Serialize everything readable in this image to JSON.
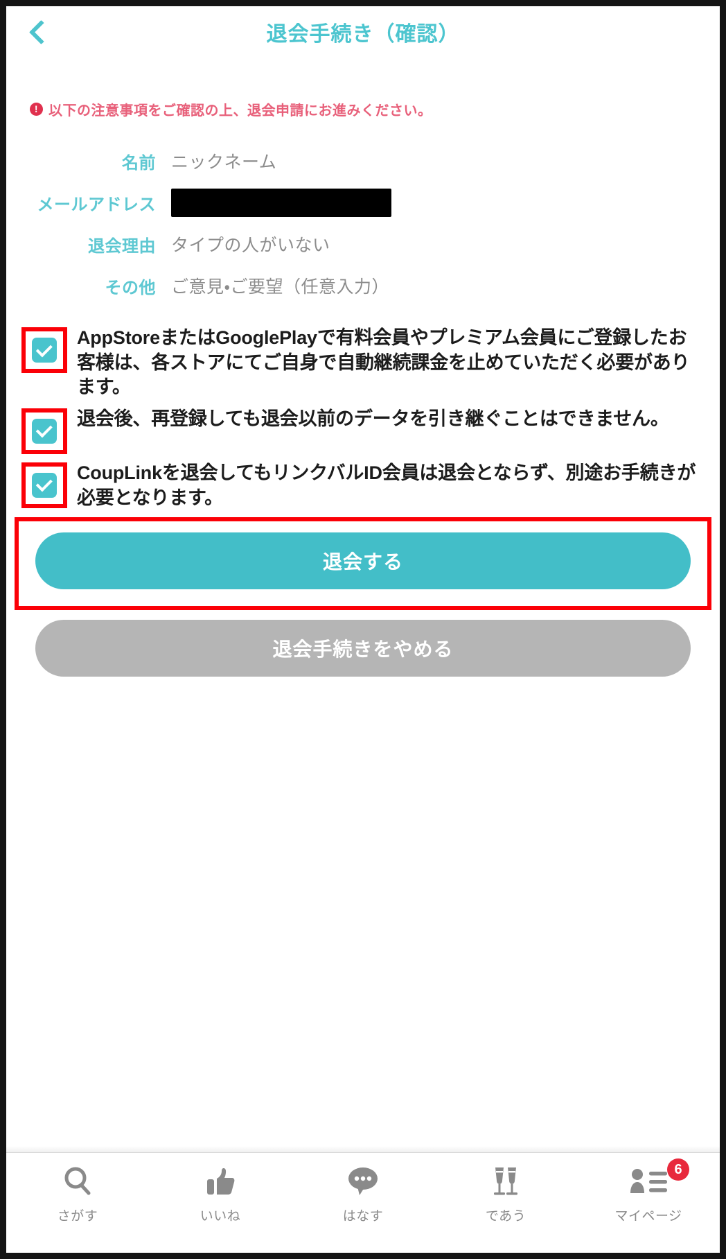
{
  "header": {
    "back_icon": "chevron-left-icon",
    "title": "退会手続き（確認）"
  },
  "main": {
    "warning": {
      "icon": "exclamation-circle-icon",
      "icon_glyph": "!",
      "text": "以下の注意事項をご確認の上、退会申請にお進みください。"
    },
    "fields": [
      {
        "label": "名前",
        "value": "ニックネーム",
        "redacted": false
      },
      {
        "label": "メールアドレス",
        "value": "",
        "redacted": true
      },
      {
        "label": "退会理由",
        "value": "タイプの人がいない",
        "redacted": false
      },
      {
        "label": "その他",
        "value": "ご意見・ご要望（任意入力）",
        "redacted": false
      }
    ],
    "checkboxes": [
      {
        "checked": true,
        "text": "AppStoreまたはGooglePlayで有料会員やプレミアム会員にご登録したお客様は、各ストアにてご自身で自動継続課金を止めていただく必要があります。"
      },
      {
        "checked": true,
        "text": "退会後、再登録しても退会以前のデータを引き継ぐことはできません。"
      },
      {
        "checked": true,
        "text": "CoupLinkを退会してもリンクバルID会員は退会とならず、別途お手続きが必要となります。"
      }
    ],
    "primary_button": "退会する",
    "secondary_button": "退会手続きをやめる"
  },
  "tabbar": {
    "items": [
      {
        "icon": "search-icon",
        "label": "さがす",
        "badge": ""
      },
      {
        "icon": "thumbs-up-icon",
        "label": "いいね",
        "badge": ""
      },
      {
        "icon": "chat-bubble-icon",
        "label": "はなす",
        "badge": ""
      },
      {
        "icon": "champagne-glasses-icon",
        "label": "であう",
        "badge": ""
      },
      {
        "icon": "person-list-icon",
        "label": "マイページ",
        "badge": "6"
      }
    ]
  },
  "colors": {
    "accent_teal": "#4cc5cf",
    "button_teal": "#43bec8",
    "button_gray": "#b5b5b5",
    "warning_red": "#e8607a",
    "annotation_red": "#fb0007",
    "badge_red": "#e8293c",
    "value_gray": "#8c8c8c"
  }
}
